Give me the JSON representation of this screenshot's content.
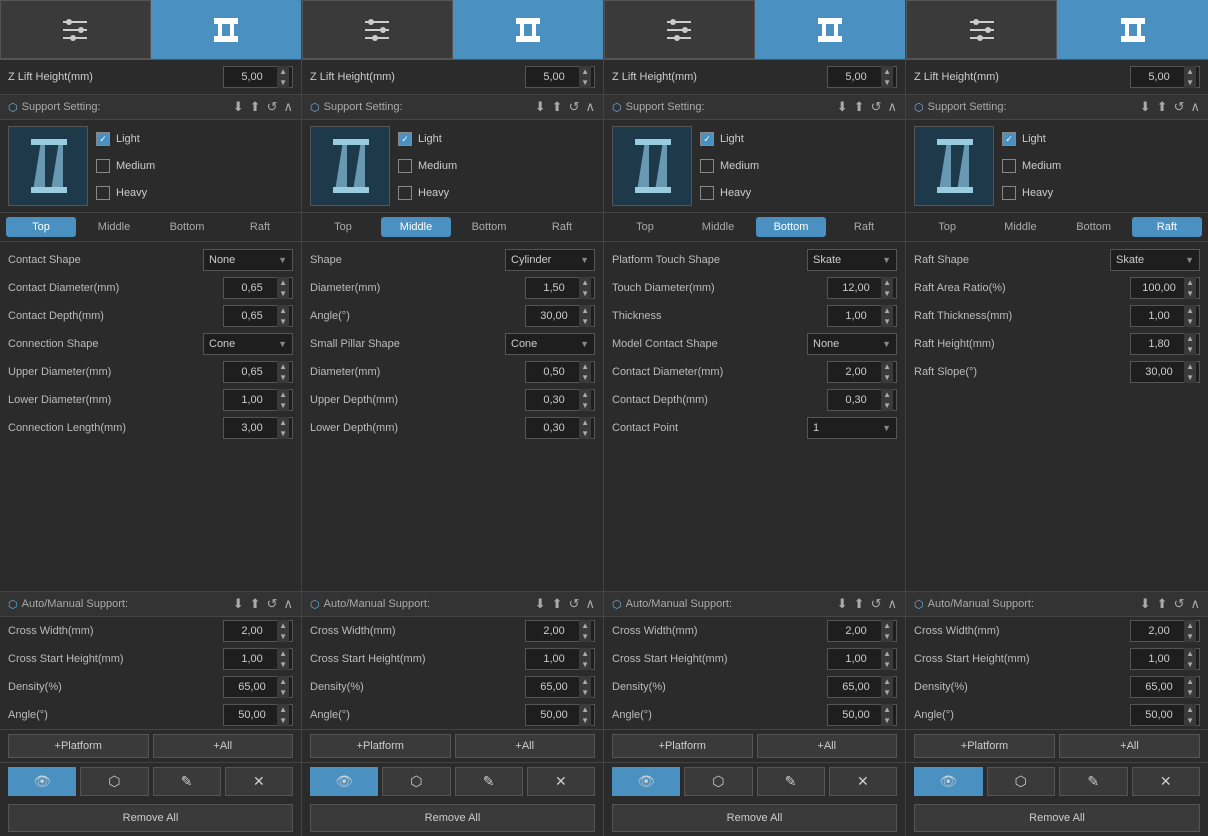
{
  "panels": [
    {
      "id": "panel1",
      "active_tab_header": 1,
      "zlift_height": "5,00",
      "support_setting_label": "Support Setting:",
      "support_type": "light",
      "active_tab": "Top",
      "tabs": [
        "Top",
        "Middle",
        "Bottom",
        "Raft"
      ],
      "form_rows": [
        {
          "label": "Contact Shape",
          "type": "dropdown",
          "value": "None"
        },
        {
          "label": "Contact Diameter(mm)",
          "type": "numbox",
          "value": "0,65"
        },
        {
          "label": "Contact Depth(mm)",
          "type": "numbox",
          "value": "0,65"
        },
        {
          "label": "Connection Shape",
          "type": "dropdown",
          "value": "Cone"
        },
        {
          "label": "Upper Diameter(mm)",
          "type": "numbox",
          "value": "0,65"
        },
        {
          "label": "Lower Diameter(mm)",
          "type": "numbox",
          "value": "1,00"
        },
        {
          "label": "Connection Length(mm)",
          "type": "numbox",
          "value": "3,00"
        }
      ],
      "auto_manual_label": "Auto/Manual Support:",
      "auto_rows": [
        {
          "label": "Cross Width(mm)",
          "value": "2,00"
        },
        {
          "label": "Cross Start Height(mm)",
          "value": "1,00"
        },
        {
          "label": "Density(%)",
          "value": "65,00"
        },
        {
          "label": "Angle(°)",
          "value": "50,00"
        }
      ],
      "btn_platform": "+Platform",
      "btn_all": "+All",
      "remove_all": "Remove All"
    },
    {
      "id": "panel2",
      "active_tab_header": 1,
      "zlift_height": "5,00",
      "support_setting_label": "Support Setting:",
      "support_type": "light",
      "active_tab": "Middle",
      "tabs": [
        "Top",
        "Middle",
        "Bottom",
        "Raft"
      ],
      "form_rows": [
        {
          "label": "Shape",
          "type": "dropdown",
          "value": "Cylinder"
        },
        {
          "label": "Diameter(mm)",
          "type": "numbox",
          "value": "1,50"
        },
        {
          "label": "Angle(°)",
          "type": "numbox",
          "value": "30,00"
        },
        {
          "label": "Small Pillar Shape",
          "type": "dropdown",
          "value": "Cone"
        },
        {
          "label": "Diameter(mm)",
          "type": "numbox",
          "value": "0,50"
        },
        {
          "label": "Upper Depth(mm)",
          "type": "numbox",
          "value": "0,30"
        },
        {
          "label": "Lower Depth(mm)",
          "type": "numbox",
          "value": "0,30"
        }
      ],
      "auto_manual_label": "Auto/Manual Support:",
      "auto_rows": [
        {
          "label": "Cross Width(mm)",
          "value": "2,00"
        },
        {
          "label": "Cross Start Height(mm)",
          "value": "1,00"
        },
        {
          "label": "Density(%)",
          "value": "65,00"
        },
        {
          "label": "Angle(°)",
          "value": "50,00"
        }
      ],
      "btn_platform": "+Platform",
      "btn_all": "+All",
      "remove_all": "Remove All"
    },
    {
      "id": "panel3",
      "active_tab_header": 1,
      "zlift_height": "5,00",
      "support_setting_label": "Support Setting:",
      "support_type": "light",
      "active_tab": "Bottom",
      "tabs": [
        "Top",
        "Middle",
        "Bottom",
        "Raft"
      ],
      "form_rows": [
        {
          "label": "Platform Touch Shape",
          "type": "dropdown",
          "value": "Skate"
        },
        {
          "label": "Touch Diameter(mm)",
          "type": "numbox",
          "value": "12,00"
        },
        {
          "label": "Thickness",
          "type": "numbox",
          "value": "1,00"
        },
        {
          "label": "Model Contact Shape",
          "type": "dropdown",
          "value": "None"
        },
        {
          "label": "Contact Diameter(mm)",
          "type": "numbox",
          "value": "2,00"
        },
        {
          "label": "Contact Depth(mm)",
          "type": "numbox",
          "value": "0,30"
        },
        {
          "label": "Contact Point",
          "type": "dropdown",
          "value": "1"
        }
      ],
      "auto_manual_label": "Auto/Manual Support:",
      "auto_rows": [
        {
          "label": "Cross Width(mm)",
          "value": "2,00"
        },
        {
          "label": "Cross Start Height(mm)",
          "value": "1,00"
        },
        {
          "label": "Density(%)",
          "value": "65,00"
        },
        {
          "label": "Angle(°)",
          "value": "50,00"
        }
      ],
      "btn_platform": "+Platform",
      "btn_all": "+All",
      "remove_all": "Remove All"
    },
    {
      "id": "panel4",
      "active_tab_header": 1,
      "zlift_height": "5,00",
      "support_setting_label": "Support Setting:",
      "support_type": "light",
      "active_tab": "Raft",
      "tabs": [
        "Top",
        "Middle",
        "Bottom",
        "Raft"
      ],
      "form_rows": [
        {
          "label": "Raft Shape",
          "type": "dropdown",
          "value": "Skate"
        },
        {
          "label": "Raft Area Ratio(%)",
          "type": "numbox",
          "value": "100,00"
        },
        {
          "label": "Raft Thickness(mm)",
          "type": "numbox",
          "value": "1,00"
        },
        {
          "label": "Raft Height(mm)",
          "type": "numbox",
          "value": "1,80"
        },
        {
          "label": "Raft Slope(°)",
          "type": "numbox",
          "value": "30,00"
        }
      ],
      "auto_manual_label": "Auto/Manual Support:",
      "auto_rows": [
        {
          "label": "Cross Width(mm)",
          "value": "2,00"
        },
        {
          "label": "Cross Start Height(mm)",
          "value": "1,00"
        },
        {
          "label": "Density(%)",
          "value": "65,00"
        },
        {
          "label": "Angle(°)",
          "value": "50,00"
        }
      ],
      "btn_platform": "+Platform",
      "btn_all": "+All",
      "remove_all": "Remove All"
    }
  ],
  "labels": {
    "light": "Light",
    "medium": "Medium",
    "heavy": "Heavy",
    "zlift": "Z Lift Height(mm)",
    "remove_all": "Remove All"
  }
}
